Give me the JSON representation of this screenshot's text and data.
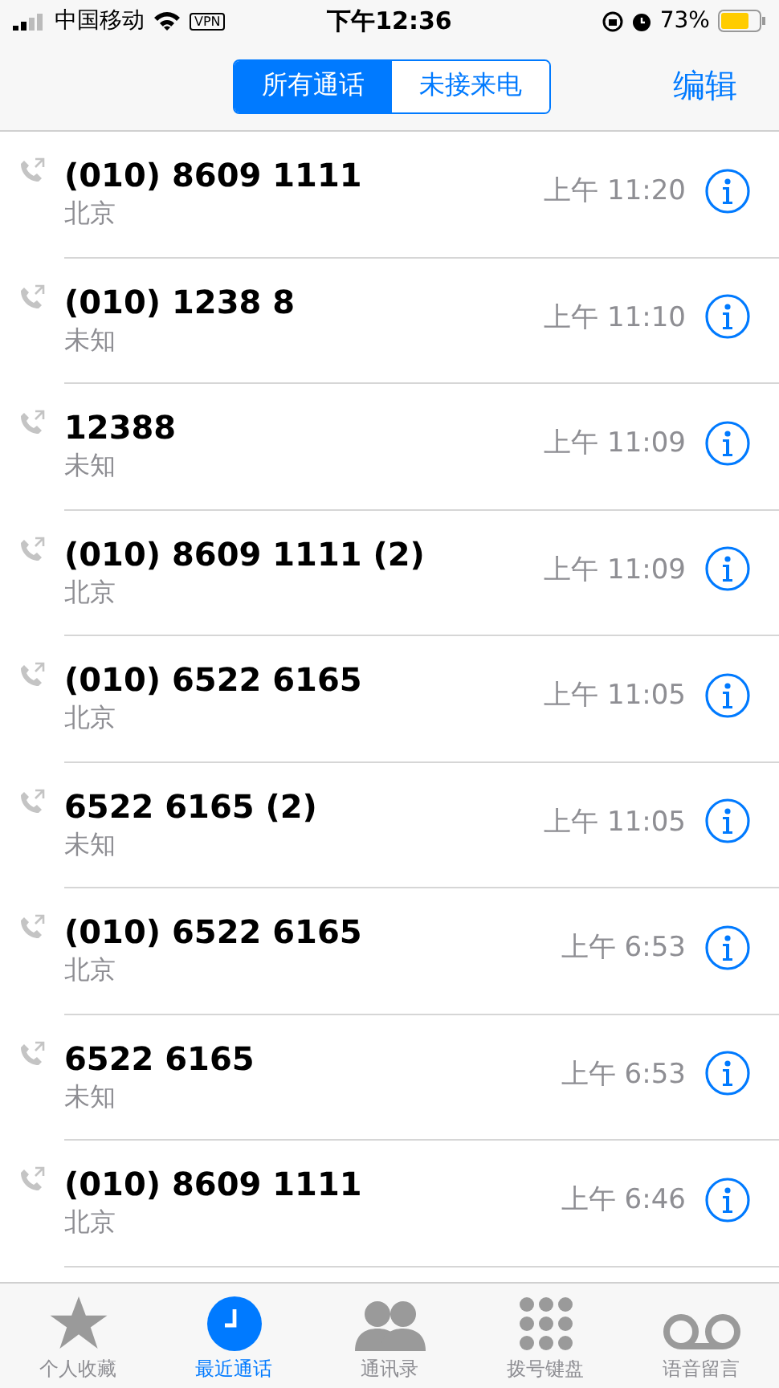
{
  "status_bar": {
    "carrier": "中国移动",
    "vpn": "VPN",
    "time": "下午12:36",
    "battery": "73%"
  },
  "segments": [
    {
      "label": "所有通话",
      "selected": true
    },
    {
      "label": "未接来电",
      "selected": false
    }
  ],
  "edit_button": "编辑",
  "calls": [
    {
      "name": "(010) 8609 1111",
      "location": "北京",
      "time": "上午 11:20"
    },
    {
      "name": "(010) 1238 8",
      "location": "未知",
      "time": "上午 11:10"
    },
    {
      "name": "12388",
      "location": "未知",
      "time": "上午 11:09"
    },
    {
      "name": "(010) 8609 1111 (2)",
      "location": "北京",
      "time": "上午 11:09"
    },
    {
      "name": "(010) 6522 6165",
      "location": "北京",
      "time": "上午 11:05"
    },
    {
      "name": "6522 6165 (2)",
      "location": "未知",
      "time": "上午 11:05"
    },
    {
      "name": "(010) 6522 6165",
      "location": "北京",
      "time": "上午 6:53"
    },
    {
      "name": "6522 6165",
      "location": "未知",
      "time": "上午 6:53"
    },
    {
      "name": "(010) 8609 1111",
      "location": "北京",
      "time": "上午 6:46"
    }
  ],
  "tab_bar": [
    {
      "kind": "favorites",
      "label": "个人收藏",
      "selected": false
    },
    {
      "kind": "recents",
      "label": "最近通话",
      "selected": true
    },
    {
      "kind": "contacts",
      "label": "通讯录",
      "selected": false
    },
    {
      "kind": "keypad",
      "label": "拨号键盘",
      "selected": false
    },
    {
      "kind": "voicemail",
      "label": "语音留言",
      "selected": false
    }
  ]
}
